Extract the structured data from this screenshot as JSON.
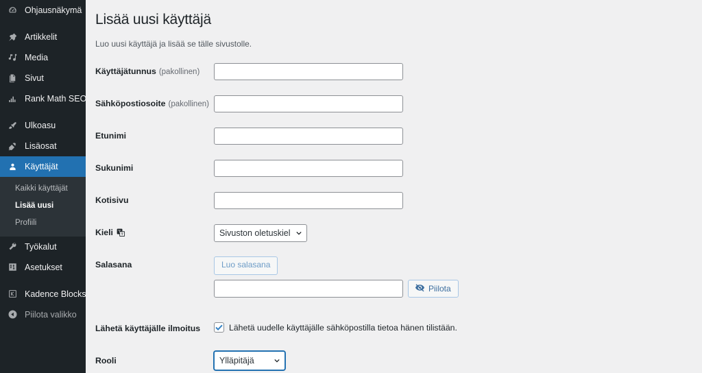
{
  "sidebar": {
    "items": [
      {
        "label": "Ohjausnäkymä",
        "icon": "dashboard-icon",
        "active": false
      },
      {
        "label": "Artikkelit",
        "icon": "pushpin-icon",
        "active": false
      },
      {
        "label": "Media",
        "icon": "media-icon",
        "active": false
      },
      {
        "label": "Sivut",
        "icon": "pages-icon",
        "active": false
      },
      {
        "label": "Rank Math SEO",
        "icon": "chart-bars-icon",
        "active": false
      },
      {
        "label": "Ulkoasu",
        "icon": "paintbrush-icon",
        "active": false
      },
      {
        "label": "Lisäosat",
        "icon": "plug-icon",
        "active": false
      },
      {
        "label": "Käyttäjät",
        "icon": "user-icon",
        "active": true
      },
      {
        "label": "Työkalut",
        "icon": "wrench-icon",
        "active": false
      },
      {
        "label": "Asetukset",
        "icon": "sliders-icon",
        "active": false
      },
      {
        "label": "Kadence Blocks",
        "icon": "kadence-k-icon",
        "active": false
      },
      {
        "label": "Piilota valikko",
        "icon": "collapse-arrow-icon",
        "active": false
      }
    ],
    "submenu": [
      {
        "label": "Kaikki käyttäjät",
        "current": false
      },
      {
        "label": "Lisää uusi",
        "current": true
      },
      {
        "label": "Profiili",
        "current": false
      }
    ]
  },
  "page": {
    "title": "Lisää uusi käyttäjä",
    "description": "Luo uusi käyttäjä ja lisää se tälle sivustolle."
  },
  "form": {
    "username": {
      "label": "Käyttäjätunnus",
      "required_note": "(pakollinen)",
      "value": "",
      "placeholder": ""
    },
    "email": {
      "label": "Sähköpostiosoite",
      "required_note": "(pakollinen)",
      "value": "",
      "placeholder": ""
    },
    "first_name": {
      "label": "Etunimi",
      "value": "",
      "placeholder": ""
    },
    "last_name": {
      "label": "Sukunimi",
      "value": "",
      "placeholder": ""
    },
    "website": {
      "label": "Kotisivu",
      "value": "",
      "placeholder": ""
    },
    "language": {
      "label": "Kieli",
      "icon": "translate-icon",
      "selected": "Sivuston oletuskieli",
      "options": [
        "Sivuston oletuskieli"
      ]
    },
    "password": {
      "label": "Salasana",
      "generate_button": "Luo salasana",
      "value": "",
      "placeholder": "",
      "hide_button": "Piilota",
      "hide_icon": "eye-slash-icon"
    },
    "notification": {
      "label": "Lähetä käyttäjälle ilmoitus",
      "checkbox_text": "Lähetä uudelle käyttäjälle sähköpostilla tietoa hänen tilistään.",
      "checked": true
    },
    "role": {
      "label": "Rooli",
      "selected": "Ylläpitäjä",
      "options": [
        "Ylläpitäjä"
      ],
      "focused": true
    }
  },
  "colors": {
    "sidebar_bg": "#1d2327",
    "submenu_bg": "#2c3338",
    "accent_blue": "#2271b1",
    "content_bg": "#f0f0f1",
    "text_dark": "#1d2327",
    "text_muted": "#50575e"
  }
}
